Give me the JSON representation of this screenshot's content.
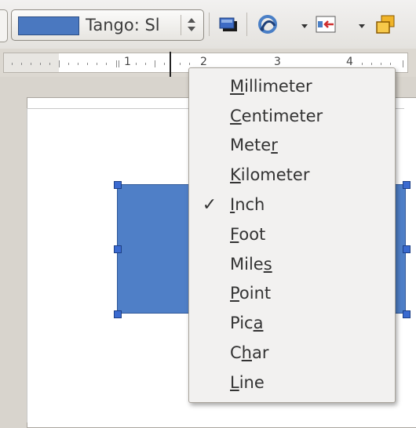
{
  "toolbar": {
    "area_fill_style": {
      "swatch_color": "#4a78c0",
      "value": "Tango: Sl"
    },
    "icons": [
      "shadow-icon",
      "curve-icon",
      "align-icon",
      "arrange-icon"
    ]
  },
  "ruler": {
    "labels": [
      "1",
      "2",
      "3",
      "4"
    ]
  },
  "shape": {
    "fill_color": "#4f7fc7"
  },
  "menu": {
    "items": [
      {
        "label": "Millimeter",
        "mnemonic": "M",
        "checked": false
      },
      {
        "label": "Centimeter",
        "mnemonic": "C",
        "checked": false
      },
      {
        "label": "Meter",
        "mnemonic": "r",
        "checked": false
      },
      {
        "label": "Kilometer",
        "mnemonic": "K",
        "checked": false
      },
      {
        "label": "Inch",
        "mnemonic": "I",
        "checked": true
      },
      {
        "label": "Foot",
        "mnemonic": "F",
        "checked": false
      },
      {
        "label": "Miles",
        "mnemonic": "s",
        "checked": false
      },
      {
        "label": "Point",
        "mnemonic": "P",
        "checked": false
      },
      {
        "label": "Pica",
        "mnemonic": "a",
        "checked": false
      },
      {
        "label": "Char",
        "mnemonic": "h",
        "checked": false
      },
      {
        "label": "Line",
        "mnemonic": "L",
        "checked": false
      }
    ]
  }
}
